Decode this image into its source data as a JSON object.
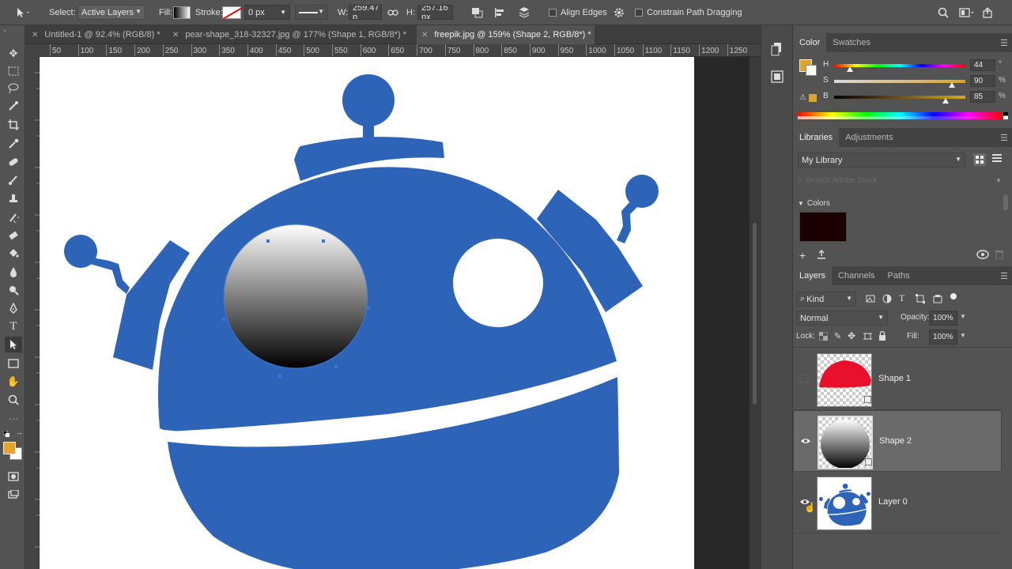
{
  "options_bar": {
    "select_label": "Select:",
    "select_value": "Active Layers",
    "fill_label": "Fill:",
    "stroke_label": "Stroke:",
    "stroke_width": "0 px",
    "w_label": "W:",
    "w_value": "259.47 p",
    "h_label": "H:",
    "h_value": "257.16 px",
    "align_edges_label": "Align Edges",
    "constrain_label": "Constrain Path Dragging"
  },
  "tabs": [
    {
      "label": "Untitled-1 @ 92.4% (RGB/8) *"
    },
    {
      "label": "pear-shape_318-32327.jpg @ 177% (Shape 1, RGB/8*) *"
    },
    {
      "label": "freepik.jpg @ 159% (Shape 2, RGB/8*) *"
    }
  ],
  "ruler_ticks": [
    "50",
    "100",
    "150",
    "200",
    "250",
    "300",
    "350",
    "400",
    "450",
    "500",
    "550",
    "600",
    "650",
    "700",
    "750",
    "800",
    "850",
    "900",
    "950",
    "1000",
    "1050",
    "1100",
    "1150",
    "1200",
    "1250"
  ],
  "color_panel": {
    "tabs": [
      "Color",
      "Swatches"
    ],
    "h_label": "H",
    "h_value": "44",
    "h_unit": "°",
    "s_label": "S",
    "s_value": "90",
    "s_unit": "%",
    "b_label": "B",
    "b_value": "85",
    "b_unit": "%",
    "h_level": 0.12,
    "s_level": 0.9,
    "b_level": 0.85,
    "foreground": "#d9a62a"
  },
  "libraries_panel": {
    "tabs": [
      "Libraries",
      "Adjustments"
    ],
    "library": "My Library",
    "search_placeholder": "Search Adobe Stock",
    "colors_label": "Colors",
    "swatch_color": "#1a0000"
  },
  "layers_panel": {
    "tabs": [
      "Layers",
      "Channels",
      "Paths"
    ],
    "filter_label": "Kind",
    "blend_mode": "Normal",
    "opacity_label": "Opacity:",
    "opacity_value": "100%",
    "lock_label": "Lock:",
    "fill_label": "Fill:",
    "fill_value": "100%",
    "layers": [
      {
        "name": "Shape 1",
        "visible": false,
        "selected": false
      },
      {
        "name": "Shape 2",
        "visible": true,
        "selected": true
      },
      {
        "name": "Layer 0",
        "visible": true,
        "selected": false
      }
    ]
  },
  "colors": {
    "robot_blue": "#2d64b8",
    "shape1_red": "#e8102a"
  }
}
